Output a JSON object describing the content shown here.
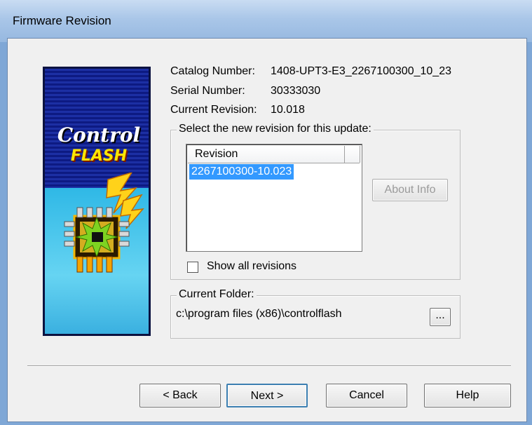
{
  "window": {
    "title": "Firmware Revision"
  },
  "logo": {
    "line1": "Control",
    "line2": "FLASH"
  },
  "info": {
    "catalog_label": "Catalog Number:",
    "catalog_value": "1408-UPT3-E3_2267100300_10_23",
    "serial_label": "Serial Number:",
    "serial_value": "30333030",
    "revision_label": "Current Revision:",
    "revision_value": "10.018"
  },
  "revision_group": {
    "legend": "Select the new revision for this update:",
    "columns": [
      "Revision",
      ""
    ],
    "rows": [
      "2267100300-10.023"
    ],
    "selected_index": 0,
    "about_button": "About Info",
    "about_enabled": false,
    "show_all_label": "Show all revisions",
    "show_all_checked": false
  },
  "folder_group": {
    "legend": "Current Folder:",
    "path": "c:\\program files (x86)\\controlflash",
    "browse_button": "..."
  },
  "footer": {
    "back": "< Back",
    "next": "Next >",
    "cancel": "Cancel",
    "help": "Help"
  },
  "colors": {
    "title_bar": "#a9c6e8",
    "selection": "#3399ff",
    "window_bg": "#f0f0f0"
  }
}
